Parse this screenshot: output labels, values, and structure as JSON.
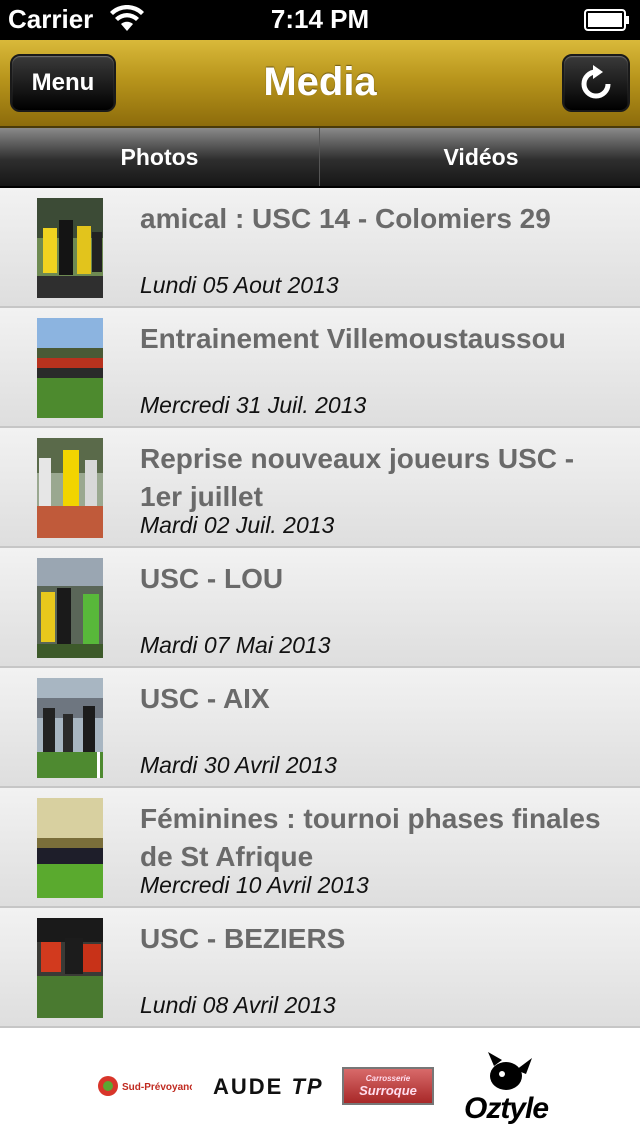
{
  "status_bar": {
    "carrier": "Carrier",
    "time": "7:14 PM",
    "wifi_icon": "wifi-icon",
    "battery_icon": "battery-icon"
  },
  "nav": {
    "title": "Media",
    "menu_label": "Menu",
    "refresh_icon": "refresh-icon",
    "background_color": "#b8951c"
  },
  "tabs": [
    {
      "label": "Photos",
      "selected": true
    },
    {
      "label": "Vidéos",
      "selected": false
    }
  ],
  "albums": [
    {
      "title": "amical : USC 14 - Colomiers 29",
      "date": "Lundi 05 Aout 2013"
    },
    {
      "title": "Entrainement Villemoustaussou",
      "date": "Mercredi 31 Juil. 2013"
    },
    {
      "title": "Reprise nouveaux joueurs USC - 1er juillet",
      "date": "Mardi 02 Juil. 2013"
    },
    {
      "title": "USC - LOU",
      "date": "Mardi 07 Mai 2013"
    },
    {
      "title": "USC - AIX",
      "date": "Mardi 30 Avril 2013"
    },
    {
      "title": "Féminines : tournoi phases finales de St Afrique",
      "date": "Mercredi 10 Avril 2013"
    },
    {
      "title": "USC - BEZIERS",
      "date": "Lundi 08 Avril 2013"
    }
  ],
  "sponsors": {
    "sud": "Sud-Prévoyance",
    "aude_main": "AUDE",
    "aude_suffix": "TP",
    "surroque_top": "Carrosserie",
    "surroque_main": "Surroque",
    "oztyle": "Oztyle"
  }
}
